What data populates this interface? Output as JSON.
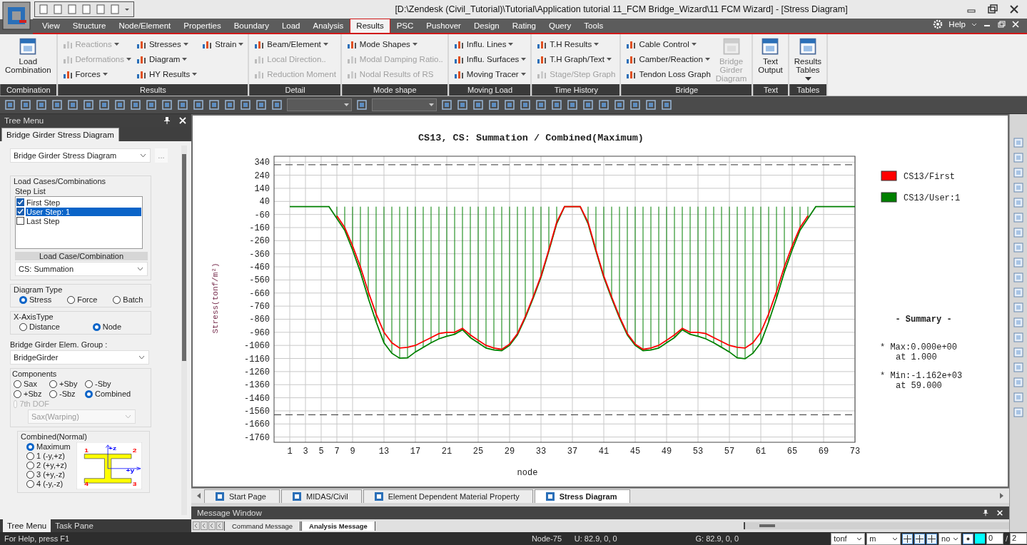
{
  "window": {
    "title": "[D:\\Zendesk (Civil_Tutorial)\\Tutorial\\Application tutorial 11_FCM Bridge_Wizard\\11 FCM Wizard] - [Stress Diagram]"
  },
  "menu_tabs": [
    {
      "label": "View",
      "selected": false
    },
    {
      "label": "Structure",
      "selected": false
    },
    {
      "label": "Node/Element",
      "selected": false
    },
    {
      "label": "Properties",
      "selected": false
    },
    {
      "label": "Boundary",
      "selected": false
    },
    {
      "label": "Load",
      "selected": false
    },
    {
      "label": "Analysis",
      "selected": false
    },
    {
      "label": "Results",
      "selected": true
    },
    {
      "label": "PSC",
      "selected": false
    },
    {
      "label": "Pushover",
      "selected": false
    },
    {
      "label": "Design",
      "selected": false
    },
    {
      "label": "Rating",
      "selected": false
    },
    {
      "label": "Query",
      "selected": false
    },
    {
      "label": "Tools",
      "selected": false
    }
  ],
  "help": "Help",
  "ribbon_groups": [
    {
      "label": "Combination",
      "items": [
        {
          "label": "Load Combination",
          "kind": "large",
          "disabled": false,
          "dropdown": false
        }
      ]
    },
    {
      "label": "Results",
      "items": [
        {
          "label": "Reactions",
          "kind": "small",
          "disabled": true,
          "dropdown": true
        },
        {
          "label": "Deformations",
          "kind": "small",
          "disabled": true,
          "dropdown": true
        },
        {
          "label": "Forces",
          "kind": "small",
          "disabled": false,
          "dropdown": true
        },
        {
          "label": "Stresses",
          "kind": "small",
          "disabled": false,
          "dropdown": true
        },
        {
          "label": "Diagram",
          "kind": "small",
          "disabled": false,
          "dropdown": true
        },
        {
          "label": "HY Results",
          "kind": "small",
          "disabled": false,
          "dropdown": true
        },
        {
          "label": "Strain",
          "kind": "small",
          "disabled": false,
          "dropdown": true
        }
      ]
    },
    {
      "label": "Detail",
      "items": [
        {
          "label": "Beam/Element",
          "kind": "small",
          "disabled": false,
          "dropdown": true
        },
        {
          "label": "Local Direction..",
          "kind": "small",
          "disabled": true,
          "dropdown": false
        },
        {
          "label": "Reduction Moment",
          "kind": "small",
          "disabled": true,
          "dropdown": false
        }
      ]
    },
    {
      "label": "Mode shape",
      "items": [
        {
          "label": "Mode Shapes",
          "kind": "small",
          "disabled": false,
          "dropdown": true
        },
        {
          "label": "Modal Damping Ratio..",
          "kind": "small",
          "disabled": true,
          "dropdown": false
        },
        {
          "label": "Nodal Results of RS",
          "kind": "small",
          "disabled": true,
          "dropdown": false
        }
      ]
    },
    {
      "label": "Moving Load",
      "items": [
        {
          "label": "Influ. Lines",
          "kind": "small",
          "disabled": false,
          "dropdown": true
        },
        {
          "label": "Influ. Surfaces",
          "kind": "small",
          "disabled": false,
          "dropdown": true
        },
        {
          "label": "Moving Tracer",
          "kind": "small",
          "disabled": false,
          "dropdown": true
        }
      ]
    },
    {
      "label": "Time History",
      "items": [
        {
          "label": "T.H Results",
          "kind": "small",
          "disabled": false,
          "dropdown": true
        },
        {
          "label": "T.H Graph/Text",
          "kind": "small",
          "disabled": false,
          "dropdown": true
        },
        {
          "label": "Stage/Step Graph",
          "kind": "small",
          "disabled": true,
          "dropdown": false
        }
      ]
    },
    {
      "label": "Bridge",
      "items": [
        {
          "label": "Cable Control",
          "kind": "small",
          "disabled": false,
          "dropdown": true
        },
        {
          "label": "Camber/Reaction",
          "kind": "small",
          "disabled": false,
          "dropdown": true
        },
        {
          "label": "Tendon Loss Graph",
          "kind": "small",
          "disabled": false,
          "dropdown": false
        },
        {
          "label": "Bridge Girder Diagram",
          "kind": "large",
          "disabled": true,
          "dropdown": false
        }
      ]
    },
    {
      "label": "Text",
      "items": [
        {
          "label": "Text Output",
          "kind": "large",
          "disabled": false,
          "dropdown": false
        }
      ]
    },
    {
      "label": "Tables",
      "items": [
        {
          "label": "Results Tables",
          "kind": "large",
          "disabled": false,
          "dropdown": true
        }
      ]
    }
  ],
  "tree_menu": {
    "title": "Tree Menu",
    "tab": "Bridge Girder Stress Diagram",
    "diagram_select": "Bridge Girder Stress Diagram",
    "more_button": "...",
    "load_cases": {
      "title": "Load Cases/Combinations",
      "step_list_label": "Step List",
      "steps": [
        {
          "label": "First Step",
          "checked": true,
          "selected": false
        },
        {
          "label": "User Step: 1",
          "checked": true,
          "selected": true
        },
        {
          "label": "Last Step",
          "checked": false,
          "selected": false
        }
      ],
      "combo_label": "Load Case/Combination",
      "combo_value": "CS: Summation"
    },
    "diagram_type": {
      "title": "Diagram Type",
      "options": [
        {
          "label": "Stress",
          "selected": true
        },
        {
          "label": "Force",
          "selected": false
        },
        {
          "label": "Batch",
          "selected": false
        }
      ]
    },
    "x_axis_type": {
      "title": "X-AxisType",
      "options": [
        {
          "label": "Distance",
          "selected": false
        },
        {
          "label": "Node",
          "selected": true
        }
      ]
    },
    "group_label": "Bridge Girder Elem. Group :",
    "group_value": "BridgeGirder",
    "components": {
      "title": "Components",
      "options": [
        {
          "label": "Sax",
          "selected": false,
          "disabled": false
        },
        {
          "label": "+Sby",
          "selected": false,
          "disabled": false
        },
        {
          "label": "-Sby",
          "selected": false,
          "disabled": false
        },
        {
          "label": "+Sbz",
          "selected": false,
          "disabled": false
        },
        {
          "label": "-Sbz",
          "selected": false,
          "disabled": false
        },
        {
          "label": "Combined",
          "selected": true,
          "disabled": false
        },
        {
          "label": "7th DOF",
          "selected": false,
          "disabled": true
        }
      ],
      "warping_value": "Sax(Warping)"
    },
    "combined_normal": {
      "title": "Combined(Normal)",
      "options": [
        {
          "label": "Maximum",
          "selected": true
        },
        {
          "label": "1 (-y,+z)",
          "selected": false
        },
        {
          "label": "2 (+y,+z)",
          "selected": false
        },
        {
          "label": "3 (+y,-z)",
          "selected": false
        },
        {
          "label": "4 (-y,-z)",
          "selected": false
        }
      ],
      "section_labels": [
        {
          "text": "1",
          "kind": "corner"
        },
        {
          "text": "+z",
          "kind": "axis"
        },
        {
          "text": "2",
          "kind": "corner"
        },
        {
          "text": "+y",
          "kind": "axis"
        },
        {
          "text": "4",
          "kind": "corner"
        },
        {
          "text": "3",
          "kind": "corner"
        }
      ]
    }
  },
  "panel_tabs": [
    {
      "label": "Tree Menu",
      "selected": true
    },
    {
      "label": "Task Pane",
      "selected": false
    }
  ],
  "chart": {
    "chart_data": {
      "type": "line",
      "title": "CS13, CS: Summation / Combined(Maximum)",
      "xlabel": "node",
      "ylabel": "Stress(tonf/m²)",
      "x": [
        1,
        2,
        3,
        4,
        5,
        6,
        7,
        8,
        9,
        10,
        11,
        12,
        13,
        14,
        15,
        16,
        17,
        18,
        19,
        20,
        21,
        22,
        23,
        24,
        25,
        26,
        27,
        28,
        29,
        30,
        31,
        32,
        33,
        34,
        35,
        36,
        37,
        38,
        39,
        40,
        41,
        42,
        43,
        44,
        45,
        46,
        47,
        48,
        49,
        50,
        51,
        52,
        53,
        54,
        55,
        56,
        57,
        58,
        59,
        60,
        61,
        62,
        63,
        64,
        65,
        66,
        67,
        68,
        69,
        70,
        71,
        72,
        73
      ],
      "series": [
        {
          "name": "CS13/First",
          "color": "#ff0000",
          "values": [
            null,
            null,
            null,
            null,
            null,
            null,
            -70,
            -160,
            -300,
            -460,
            -650,
            -820,
            -960,
            -1040,
            -1080,
            -1075,
            -1060,
            -1030,
            -1000,
            -970,
            -960,
            -960,
            -930,
            -980,
            -1020,
            -1060,
            -1080,
            -1090,
            -1050,
            -970,
            -840,
            -690,
            -530,
            -330,
            -120,
            0,
            0,
            0,
            -120,
            -330,
            -530,
            -690,
            -840,
            -970,
            -1050,
            -1090,
            -1080,
            -1060,
            -1020,
            -980,
            -930,
            -960,
            -960,
            -970,
            -1000,
            -1030,
            -1060,
            -1075,
            -1080,
            -1040,
            -960,
            -820,
            -650,
            -460,
            -300,
            -160,
            -70,
            null,
            null,
            null,
            null,
            null,
            null
          ]
        },
        {
          "name": "CS13/User:1",
          "color": "#008000",
          "values": [
            0,
            0,
            0,
            0,
            0,
            0,
            -90,
            -180,
            -330,
            -500,
            -700,
            -880,
            -1040,
            -1120,
            -1158,
            -1155,
            -1110,
            -1075,
            -1040,
            -1010,
            -990,
            -975,
            -940,
            -1000,
            -1040,
            -1080,
            -1095,
            -1100,
            -1060,
            -980,
            -850,
            -700,
            -540,
            -340,
            -130,
            0,
            0,
            0,
            -130,
            -340,
            -540,
            -700,
            -850,
            -980,
            -1060,
            -1100,
            -1095,
            -1080,
            -1040,
            -1000,
            -940,
            -975,
            -990,
            -1010,
            -1040,
            -1075,
            -1110,
            -1155,
            -1162,
            -1120,
            -1040,
            -880,
            -700,
            -500,
            -330,
            -180,
            -90,
            0,
            0,
            0,
            0,
            0,
            0
          ]
        }
      ],
      "xlim": [
        -1,
        73
      ],
      "ylim": [
        -1800,
        385
      ],
      "xticks": [
        1,
        3,
        5,
        7,
        9,
        13,
        17,
        21,
        25,
        29,
        33,
        37,
        41,
        45,
        49,
        53,
        57,
        61,
        65,
        69,
        73
      ],
      "yticks": [
        340,
        240,
        140,
        40,
        -60,
        -160,
        -260,
        -360,
        -460,
        -560,
        -660,
        -760,
        -860,
        -960,
        -1060,
        -1160,
        -1260,
        -1360,
        -1460,
        -1560,
        -1660,
        -1760
      ],
      "grid": true,
      "legend": "right",
      "ref_lines": [
        {
          "axis": "y",
          "value": 320
        },
        {
          "axis": "y",
          "value": -1590
        }
      ]
    },
    "summary": {
      "title": "- Summary -",
      "lines": [
        "* Max:0.000e+00",
        "at  1.000",
        "* Min:-1.162e+03",
        "at 59.000"
      ]
    }
  },
  "document_tabs": [
    {
      "label": "Start Page",
      "selected": false
    },
    {
      "label": "MIDAS/Civil",
      "selected": false
    },
    {
      "label": "Element Dependent Material Property",
      "selected": false
    },
    {
      "label": "Stress Diagram",
      "selected": true
    }
  ],
  "message_window": {
    "title": "Message Window",
    "tabs": [
      {
        "label": "Command Message",
        "selected": false
      },
      {
        "label": "Analysis Message",
        "selected": true
      }
    ]
  },
  "status_bar": {
    "help": "For Help, press F1",
    "node": "Node-75",
    "u": "U: 82.9, 0, 0",
    "g": "G: 82.9, 0, 0",
    "force_unit": "tonf",
    "length_unit": "m",
    "option": "no",
    "spin_1": "0",
    "separator": "/",
    "spin_2": "2"
  }
}
